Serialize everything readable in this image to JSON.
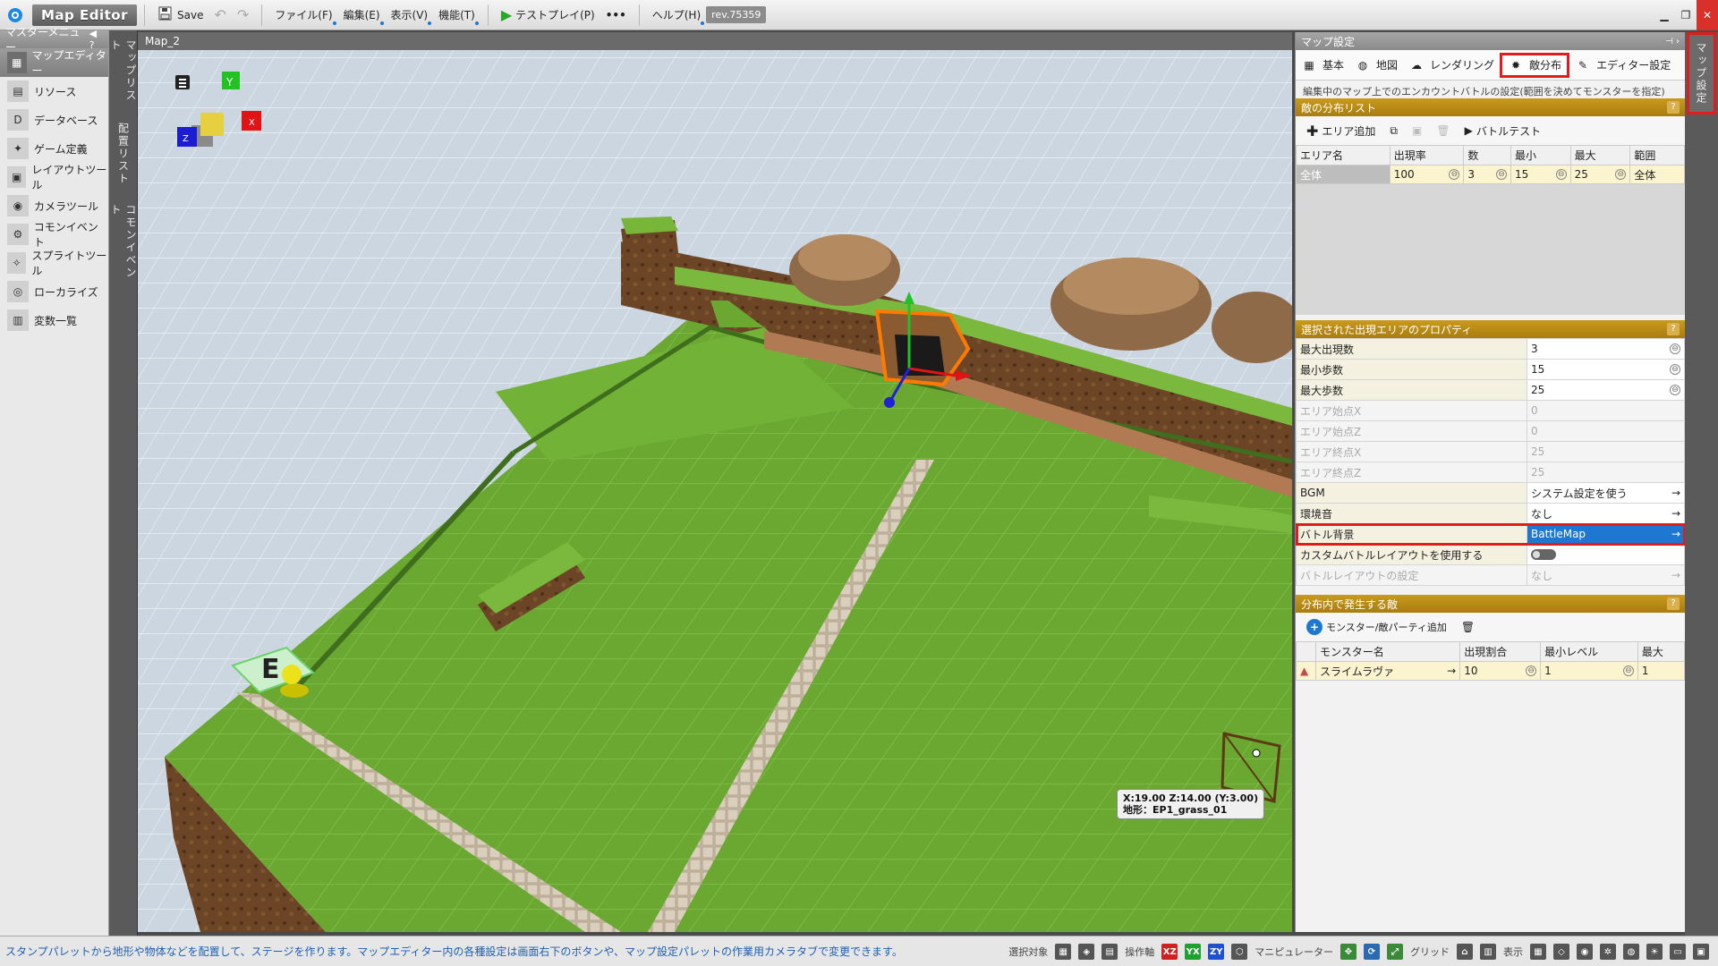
{
  "app": {
    "title": "Map Editor",
    "save_label": "Save",
    "menus": [
      "ファイル(F)",
      "編集(E)",
      "表示(V)",
      "機能(T)"
    ],
    "testplay_label": "テストプレイ(P)",
    "more_label": "•••",
    "help_label": "ヘルプ(H)",
    "revision": "rev.75359"
  },
  "master_menu": {
    "title": "マスターメニュー",
    "items": [
      {
        "label": "マップエディター",
        "icon": "map-editor-icon",
        "active": true
      },
      {
        "label": "リソース",
        "icon": "resource-icon"
      },
      {
        "label": "データベース",
        "icon": "database-icon"
      },
      {
        "label": "ゲーム定義",
        "icon": "game-definition-icon"
      },
      {
        "label": "レイアウトツール",
        "icon": "layout-tool-icon"
      },
      {
        "label": "カメラツール",
        "icon": "camera-tool-icon"
      },
      {
        "label": "コモンイベント",
        "icon": "common-event-icon"
      },
      {
        "label": "スプライトツール",
        "icon": "sprite-tool-icon"
      },
      {
        "label": "ローカライズ",
        "icon": "localize-icon"
      },
      {
        "label": "変数一覧",
        "icon": "variables-icon"
      }
    ]
  },
  "vertical_tabs": [
    "マップリスト",
    "配置リスト",
    "コモンイベント"
  ],
  "viewport": {
    "title": "Map_2",
    "gizmo_labels": {
      "y": "Y",
      "x": "X",
      "z": "Z"
    },
    "entrance_label": "E",
    "coord_line1": "X:19.00 Z:14.00 (Y:3.00)",
    "coord_line2": "地形：EP1_grass_01"
  },
  "right_panel": {
    "title": "マップ設定",
    "tabs": [
      {
        "label": "基本",
        "icon": "basic-settings-icon"
      },
      {
        "label": "地図",
        "icon": "world-map-icon"
      },
      {
        "label": "レンダリング",
        "icon": "rendering-icon"
      },
      {
        "label": "敵分布",
        "icon": "enemy-distribution-icon",
        "highlighted": true
      },
      {
        "label": "エディター設定",
        "icon": "editor-settings-icon"
      }
    ],
    "description": "編集中のマップ上でのエンカウントバトルの設定(範囲を決めてモンスターを指定)",
    "distribution_section": {
      "title": "敵の分布リスト",
      "help": "?",
      "add_area_label": "エリア追加",
      "battle_test_label": "バトルテスト",
      "columns": [
        "エリア名",
        "出現率",
        "数",
        "最小",
        "最大",
        "範囲"
      ],
      "rows": [
        {
          "name": "全体",
          "rate": "100",
          "count": "3",
          "min": "15",
          "max": "25",
          "range": "全体"
        }
      ]
    },
    "props_section": {
      "title": "選択された出現エリアのプロパティ",
      "help": "?",
      "rows": [
        {
          "key": "最大出現数",
          "value": "3",
          "state": "spin"
        },
        {
          "key": "最小歩数",
          "value": "15",
          "state": "spin"
        },
        {
          "key": "最大歩数",
          "value": "25",
          "state": "spin"
        },
        {
          "key": "エリア始点X",
          "value": "0",
          "state": "disabled"
        },
        {
          "key": "エリア始点Z",
          "value": "0",
          "state": "disabled"
        },
        {
          "key": "エリア終点X",
          "value": "25",
          "state": "disabled"
        },
        {
          "key": "エリア終点Z",
          "value": "25",
          "state": "disabled"
        },
        {
          "key": "BGM",
          "value": "システム設定を使う",
          "state": "arrow"
        },
        {
          "key": "環境音",
          "value": "なし",
          "state": "arrow"
        },
        {
          "key": "バトル背景",
          "value": "BattleMap",
          "state": "highlight"
        },
        {
          "key": "カスタムバトルレイアウトを使用する",
          "value": "",
          "state": "toggle"
        },
        {
          "key": "バトルレイアウトの設定",
          "value": "なし",
          "state": "disabled-arrow"
        }
      ]
    },
    "monster_section": {
      "title": "分布内で発生する敵",
      "help": "?",
      "add_label": "モンスター/敵パーティ追加",
      "columns": [
        "モンスター名",
        "出現割合",
        "最小レベル",
        "最大"
      ],
      "rows": [
        {
          "name": "スライムラヴァ",
          "rate": "10",
          "min_level": "1",
          "max": "1"
        }
      ]
    }
  },
  "side_tab": "マップ設定",
  "status": {
    "message": "スタンプパレットから地形や物体などを配置して、ステージを作ります。マップエディター内の各種設定は画面右下のボタンや、マップ設定パレットの作業用カメラタブで変更できます。",
    "labels": {
      "select_target": "選択対象",
      "axis": "操作軸",
      "manipulator": "マニピュレーター",
      "grid": "グリッド",
      "display": "表示"
    },
    "axis_buttons": [
      "XZ",
      "YX",
      "ZY"
    ]
  }
}
